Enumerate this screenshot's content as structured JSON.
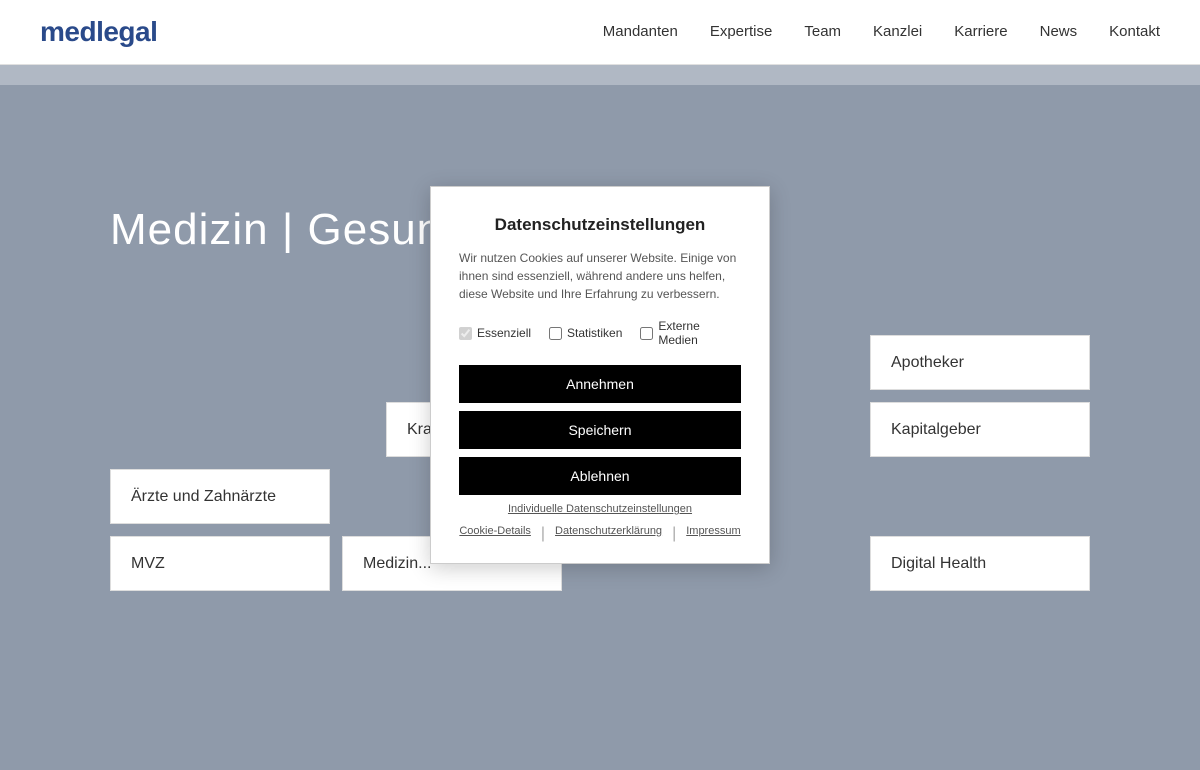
{
  "header": {
    "logo": "medlegal",
    "nav": [
      {
        "label": "Mandanten",
        "href": "#"
      },
      {
        "label": "Expertise",
        "href": "#"
      },
      {
        "label": "Team",
        "href": "#"
      },
      {
        "label": "Kanzlei",
        "href": "#"
      },
      {
        "label": "Karriere",
        "href": "#"
      },
      {
        "label": "News",
        "href": "#"
      },
      {
        "label": "Kontakt",
        "href": "#"
      }
    ]
  },
  "hero": {
    "title": "Medizin | Gesundheit | Recht"
  },
  "cards": [
    {
      "id": "apotheker",
      "label": "Apotheker"
    },
    {
      "id": "krankenkassen",
      "label": "Krankenkassen"
    },
    {
      "id": "middle-top",
      "label": ""
    },
    {
      "id": "kapitalgeber",
      "label": "Kapitalgeber"
    },
    {
      "id": "aerzte",
      "label": "Ärzte und Zahnärzte"
    },
    {
      "id": "mvz",
      "label": "MVZ"
    },
    {
      "id": "medizin-produkte",
      "label": "Medizin..."
    },
    {
      "id": "digital-health",
      "label": "Digital Health"
    }
  ],
  "cookie": {
    "title": "Datenschutzeinstellungen",
    "description": "Wir nutzen Cookies auf unserer Website. Einige von ihnen sind essenziell, während andere uns helfen, diese Website und Ihre Erfahrung zu verbessern.",
    "checkboxes": [
      {
        "id": "essenziell",
        "label": "Essenziell",
        "checked": true,
        "disabled": true
      },
      {
        "id": "statistiken",
        "label": "Statistiken",
        "checked": false
      },
      {
        "id": "externe-medien",
        "label": "Externe Medien",
        "checked": false
      }
    ],
    "buttons": [
      {
        "id": "annehmen",
        "label": "Annehmen"
      },
      {
        "id": "speichern",
        "label": "Speichern"
      },
      {
        "id": "ablehnen",
        "label": "Ablehnen"
      }
    ],
    "links": [
      {
        "id": "individuelle",
        "label": "Individuelle Datenschutzeinstellungen"
      },
      {
        "id": "cookie-details",
        "label": "Cookie-Details"
      },
      {
        "id": "datenschutz",
        "label": "Datenschutzerklärung"
      },
      {
        "id": "impressum",
        "label": "Impressum"
      }
    ]
  }
}
